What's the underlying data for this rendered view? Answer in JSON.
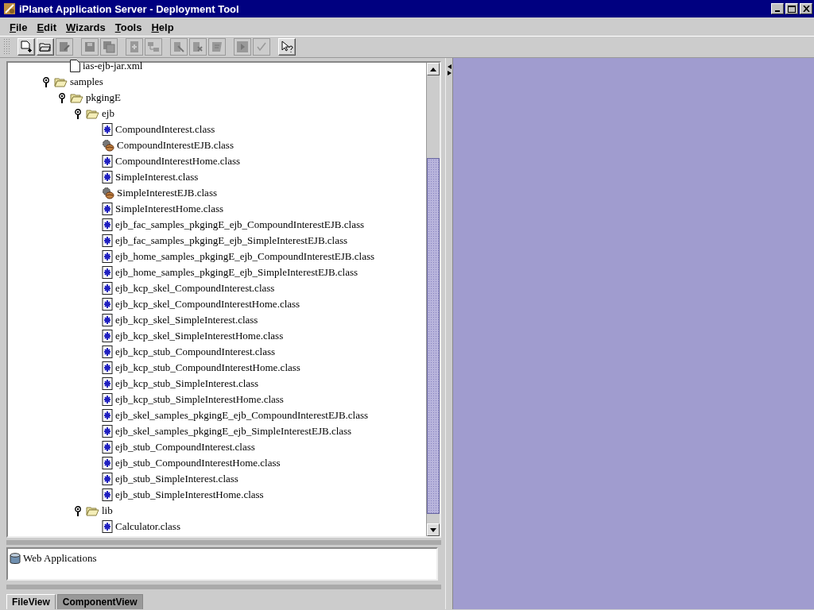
{
  "window": {
    "title": "iPlanet Application Server - Deployment Tool"
  },
  "menu": [
    "File",
    "Edit",
    "Wizards",
    "Tools",
    "Help"
  ],
  "toolbar": [
    [
      {
        "kind": "new",
        "disabled": false
      },
      {
        "kind": "open",
        "disabled": false
      },
      {
        "kind": "properties",
        "disabled": true
      }
    ],
    [
      {
        "kind": "save",
        "disabled": true
      },
      {
        "kind": "save-all",
        "disabled": true
      }
    ],
    [
      {
        "kind": "add",
        "disabled": true
      },
      {
        "kind": "move",
        "disabled": true
      }
    ],
    [
      {
        "kind": "edit",
        "disabled": true
      },
      {
        "kind": "remove",
        "disabled": true
      },
      {
        "kind": "notes",
        "disabled": true
      }
    ],
    [
      {
        "kind": "run",
        "disabled": true
      },
      {
        "kind": "check",
        "disabled": true
      }
    ],
    [
      {
        "kind": "help",
        "disabled": false
      }
    ]
  ],
  "tree": {
    "above": [
      {
        "label": "ias-ejb-jar.xml",
        "kind": "xml"
      }
    ],
    "items": [
      {
        "label": "samples",
        "kind": "folder",
        "expanded": true,
        "children": [
          {
            "label": "pkgingE",
            "kind": "folder",
            "expanded": true,
            "children": [
              {
                "label": "ejb",
                "kind": "folder",
                "expanded": true,
                "children": [
                  {
                    "label": "CompoundInterest.class",
                    "kind": "class"
                  },
                  {
                    "label": "CompoundInterestEJB.class",
                    "kind": "bean"
                  },
                  {
                    "label": "CompoundInterestHome.class",
                    "kind": "class"
                  },
                  {
                    "label": "SimpleInterest.class",
                    "kind": "class"
                  },
                  {
                    "label": "SimpleInterestEJB.class",
                    "kind": "bean"
                  },
                  {
                    "label": "SimpleInterestHome.class",
                    "kind": "class"
                  },
                  {
                    "label": "ejb_fac_samples_pkgingE_ejb_CompoundInterestEJB.class",
                    "kind": "class"
                  },
                  {
                    "label": "ejb_fac_samples_pkgingE_ejb_SimpleInterestEJB.class",
                    "kind": "class"
                  },
                  {
                    "label": "ejb_home_samples_pkgingE_ejb_CompoundInterestEJB.class",
                    "kind": "class"
                  },
                  {
                    "label": "ejb_home_samples_pkgingE_ejb_SimpleInterestEJB.class",
                    "kind": "class"
                  },
                  {
                    "label": "ejb_kcp_skel_CompoundInterest.class",
                    "kind": "class"
                  },
                  {
                    "label": "ejb_kcp_skel_CompoundInterestHome.class",
                    "kind": "class"
                  },
                  {
                    "label": "ejb_kcp_skel_SimpleInterest.class",
                    "kind": "class"
                  },
                  {
                    "label": "ejb_kcp_skel_SimpleInterestHome.class",
                    "kind": "class"
                  },
                  {
                    "label": "ejb_kcp_stub_CompoundInterest.class",
                    "kind": "class"
                  },
                  {
                    "label": "ejb_kcp_stub_CompoundInterestHome.class",
                    "kind": "class"
                  },
                  {
                    "label": "ejb_kcp_stub_SimpleInterest.class",
                    "kind": "class"
                  },
                  {
                    "label": "ejb_kcp_stub_SimpleInterestHome.class",
                    "kind": "class"
                  },
                  {
                    "label": "ejb_skel_samples_pkgingE_ejb_CompoundInterestEJB.class",
                    "kind": "class"
                  },
                  {
                    "label": "ejb_skel_samples_pkgingE_ejb_SimpleInterestEJB.class",
                    "kind": "class"
                  },
                  {
                    "label": "ejb_stub_CompoundInterest.class",
                    "kind": "class"
                  },
                  {
                    "label": "ejb_stub_CompoundInterestHome.class",
                    "kind": "class"
                  },
                  {
                    "label": "ejb_stub_SimpleInterest.class",
                    "kind": "class"
                  },
                  {
                    "label": "ejb_stub_SimpleInterestHome.class",
                    "kind": "class"
                  }
                ]
              },
              {
                "label": "lib",
                "kind": "folder",
                "expanded": true,
                "children": [
                  {
                    "label": "Calculator.class",
                    "kind": "class"
                  }
                ]
              }
            ]
          }
        ]
      }
    ]
  },
  "modules": [
    {
      "label": "Web Applications",
      "kind": "database"
    }
  ],
  "tabs": [
    {
      "label": "FileView",
      "selected": true
    },
    {
      "label": "ComponentView",
      "selected": false
    }
  ]
}
